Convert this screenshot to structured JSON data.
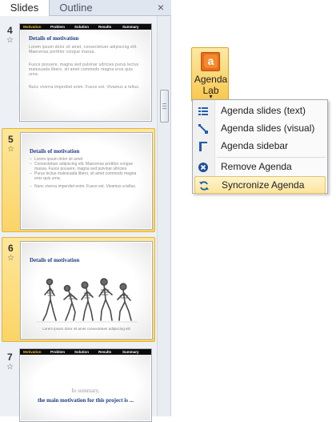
{
  "pane": {
    "tabs": [
      {
        "label": "Slides",
        "active": true
      },
      {
        "label": "Outline",
        "active": false
      }
    ],
    "close_glyph": "×"
  },
  "slides": [
    {
      "number": "4",
      "nav": [
        "Motivation",
        "Problem",
        "Solution",
        "Results",
        "Summary"
      ],
      "title": "Details of motivation",
      "paragraphs": [
        "Lorem ipsum dolor sit amet, consectetuer adipiscing elit. Maecenas porttitor congue massa.",
        "Fusce posuere, magna sed pulvinar ultricies purus lectus malesuada libero, sit amet commodo magna eros quis urna.",
        "Nunc viverra imperdiet enim. Fusce est. Vivamus a tellus."
      ]
    },
    {
      "number": "5",
      "title": "Details of motivation",
      "bullets": [
        "Lorem ipsum dolor sit amet",
        "Consectetuer adipiscing elit. Maecenas porttitor congue massa. Fusce posuere, magna sed pulvinar ultricies",
        "Purus lectus malesuada libero, sit amet commodo magna eros quis urna.",
        "Nunc viverra imperdiet enim. Fusce est. Vivamus a tellus."
      ]
    },
    {
      "number": "6",
      "title": "Details of motivation",
      "caption": "Lorem ipsum dolor sit amet consectetuer adipiscing elit"
    },
    {
      "number": "7",
      "nav": [
        "Motivation",
        "Problem",
        "Solution",
        "Results",
        "Summary"
      ],
      "summary_line1": "In summary,",
      "summary_line2": "the main motivation for this project is ..."
    }
  ],
  "agenda_button": {
    "line1": "Agenda",
    "line2": "Lab",
    "dropdown_glyph": "▾",
    "logo_letter": "a"
  },
  "menu": {
    "items": [
      {
        "label": "Agenda slides (text)",
        "icon": "bullet-list-icon"
      },
      {
        "label": "Agenda slides (visual)",
        "icon": "visual-agenda-icon"
      },
      {
        "label": "Agenda sidebar",
        "icon": "sidebar-icon"
      },
      {
        "label": "Remove Agenda",
        "icon": "remove-circle-icon"
      },
      {
        "label": "Syncronize Agenda",
        "icon": "sync-icon"
      }
    ]
  },
  "colors": {
    "selection": "#fbd467",
    "accent_blue": "#1f3b82",
    "agenda_orange": "#e86d1b",
    "menu_icon_blue": "#1f5fae"
  }
}
